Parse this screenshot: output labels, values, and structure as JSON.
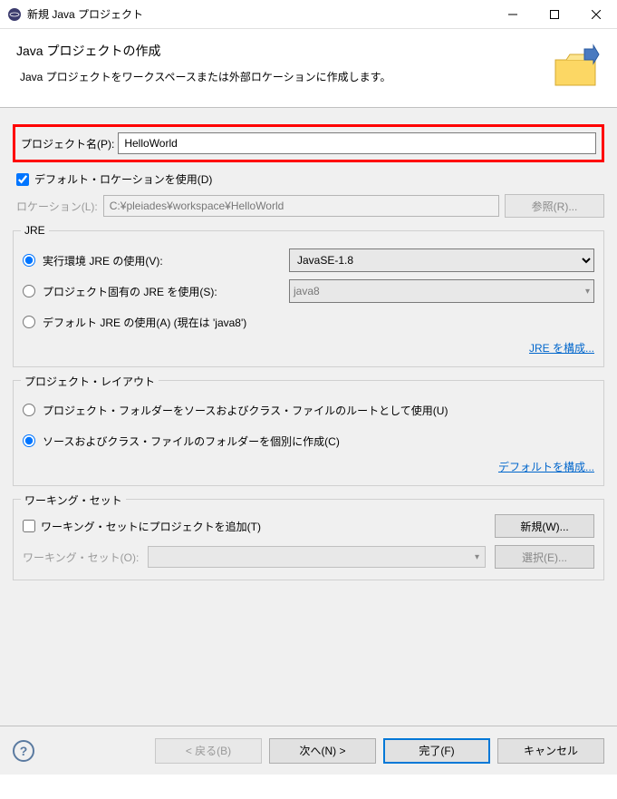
{
  "titlebar": {
    "title": "新規 Java プロジェクト"
  },
  "header": {
    "title": "Java プロジェクトの作成",
    "desc": "Java プロジェクトをワークスペースまたは外部ロケーションに作成します。"
  },
  "project_name": {
    "label": "プロジェクト名(P):",
    "value": "HelloWorld"
  },
  "use_default_location": {
    "label": "デフォルト・ロケーションを使用(D)"
  },
  "location": {
    "label": "ロケーション(L):",
    "value": "C:¥pleiades¥workspace¥HelloWorld",
    "browse": "参照(R)..."
  },
  "jre": {
    "legend": "JRE",
    "exec_env": {
      "label": "実行環境 JRE の使用(V):",
      "selected": "JavaSE-1.8"
    },
    "project_jre": {
      "label": "プロジェクト固有の JRE を使用(S):",
      "selected": "java8"
    },
    "default_jre": {
      "label": "デフォルト JRE の使用(A) (現在は 'java8')"
    },
    "config_link": "JRE を構成..."
  },
  "layout": {
    "legend": "プロジェクト・レイアウト",
    "opt1": "プロジェクト・フォルダーをソースおよびクラス・ファイルのルートとして使用(U)",
    "opt2": "ソースおよびクラス・ファイルのフォルダーを個別に作成(C)",
    "config_link": "デフォルトを構成..."
  },
  "working_set": {
    "legend": "ワーキング・セット",
    "add_label": "ワーキング・セットにプロジェクトを追加(T)",
    "new_btn": "新規(W)...",
    "combo_label": "ワーキング・セット(O):",
    "select_btn": "選択(E)..."
  },
  "footer": {
    "back": "< 戻る(B)",
    "next": "次へ(N) >",
    "finish": "完了(F)",
    "cancel": "キャンセル"
  }
}
